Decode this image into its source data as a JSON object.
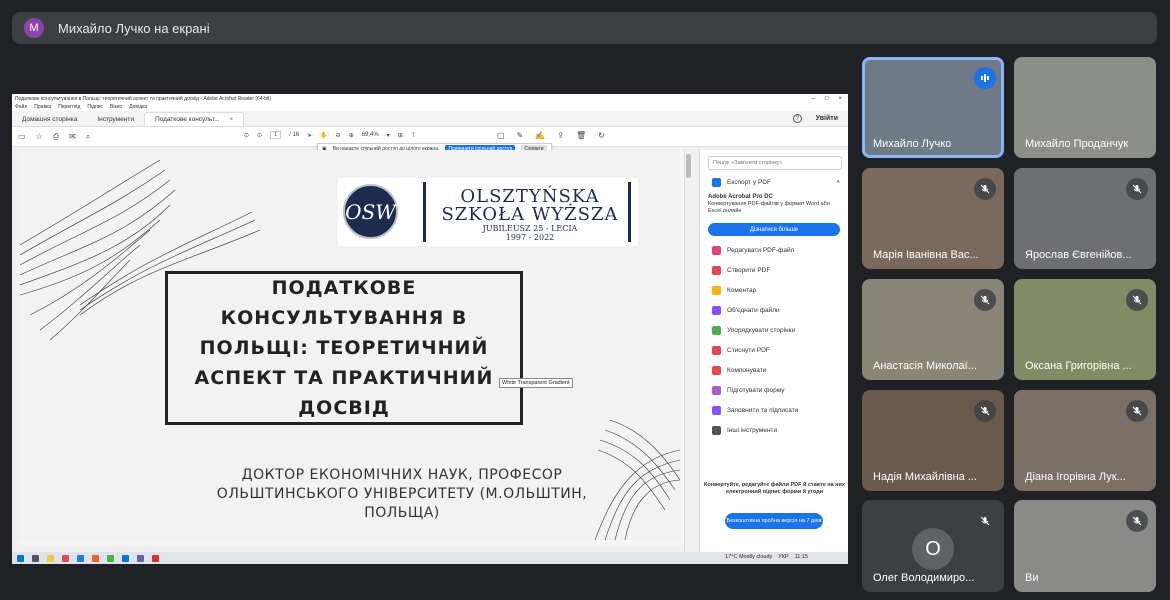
{
  "presenter": {
    "initial": "M",
    "label": "Михайло Лучко на екрані"
  },
  "acrobat": {
    "window_title": "Податкове консультування в Польщі: теоретичний аспект та практичний досвід - Adobe Acrobat Reader (64-bit)",
    "menu": [
      "Файл",
      "Правка",
      "Перегляд",
      "Підпис",
      "Вікно",
      "Довідка"
    ],
    "tabs": [
      "Домашня сторінка",
      "Інструменти",
      "Податкове консульт..."
    ],
    "login": "Увійти",
    "page_current": "1",
    "page_total": "/ 16",
    "zoom": "69,4%",
    "share_notice": "Ви надаєте спільний доступ до цілого екрана.",
    "share_stop": "Припинити спільний доступ",
    "share_hide": "Сховати"
  },
  "slide": {
    "logo_mark": "OSW",
    "logo_line1": "OLSZTYŃSKA",
    "logo_line2": "SZKOŁA WYŻSZA",
    "logo_line3": "JUBILEUSZ 25 - LECIA",
    "logo_line4": "1997 - 2022",
    "title": "ПОДАТКОВЕ КОНСУЛЬТУВАННЯ В ПОЛЬЩІ: ТЕОРЕТИЧНИЙ АСПЕКТ ТА ПРАКТИЧНИЙ ДОСВІД",
    "author": "ДОКТОР ЕКОНОМІЧНИХ НАУК, ПРОФЕСОР ОЛЬШТИНСЬКОГО УНІВЕРСИТЕТУ (М.ОЛЬШТИН, ПОЛЬЩА)",
    "tooltip": "White Transparent Gradient"
  },
  "sidepanel": {
    "search_placeholder": "Пошук «Замінити сторінку»",
    "export_label": "Експорт у PDF",
    "promo_title": "Adobe Acrobat Pro DC",
    "promo_text": "Конвертування PDF-файлів у формат Word або Excel онлайн",
    "promo_btn": "Дізнатися більше",
    "tools": [
      {
        "label": "Редагувати PDF-файл",
        "color": "#e0457b"
      },
      {
        "label": "Створити PDF",
        "color": "#e34850"
      },
      {
        "label": "Коментар",
        "color": "#f5b400"
      },
      {
        "label": "Об'єднати файли",
        "color": "#8a4fff"
      },
      {
        "label": "Упорядкувати сторінки",
        "color": "#4caf50"
      },
      {
        "label": "Стиснути PDF",
        "color": "#e34850"
      },
      {
        "label": "Компонувати",
        "color": "#e34850"
      },
      {
        "label": "Підготувати форму",
        "color": "#b05cc8"
      },
      {
        "label": "Заповнити та підписати",
        "color": "#8a4fff"
      },
      {
        "label": "Інші інструменти",
        "color": "#555555"
      }
    ],
    "footer_text": "Конвертуйте, редагуйте файли PDF й ставте на них електронний підпис форми й угоди",
    "trial_btn": "Безкоштовна пробна версія на 7 днів"
  },
  "taskbar": {
    "weather": "17°C  Mostly cloudy",
    "lang": "УКР",
    "time": "11:15"
  },
  "participants": [
    {
      "name": "Михайло Лучко",
      "state": "speaking"
    },
    {
      "name": "Михайло Проданчук",
      "state": "on"
    },
    {
      "name": "Марія Іванівна Вас...",
      "state": "muted"
    },
    {
      "name": "Ярослав Євгенійов...",
      "state": "muted"
    },
    {
      "name": "Анастасія Миколаї...",
      "state": "muted"
    },
    {
      "name": "Оксана Григорівна ...",
      "state": "muted"
    },
    {
      "name": "Надія Михайлівна ...",
      "state": "muted"
    },
    {
      "name": "Діана Ігорівна Лук...",
      "state": "muted"
    },
    {
      "name": "Олег Володимиро...",
      "state": "muted",
      "initial": "О"
    },
    {
      "name": "Ви",
      "state": "muted"
    }
  ]
}
